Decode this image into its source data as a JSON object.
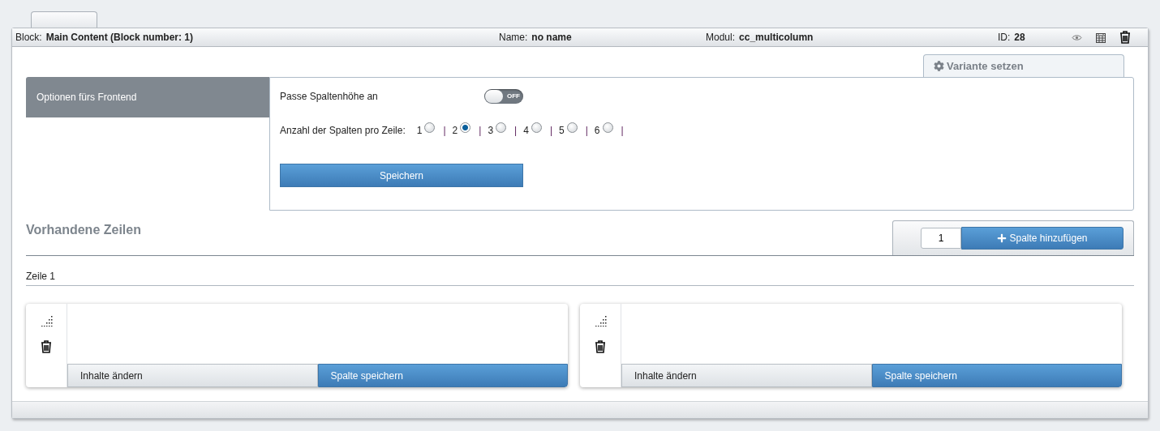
{
  "header": {
    "block_label": "Block:",
    "block_value": "Main Content (Block number: 1)",
    "name_label": "Name:",
    "name_value": "no name",
    "module_label": "Modul:",
    "module_value": "cc_multicolumn",
    "id_label": "ID:",
    "id_value": "28"
  },
  "variant_tab": {
    "label": "Variante setzen"
  },
  "options": {
    "title": "Optionen fürs Frontend",
    "toggle": {
      "label": "Passe Spaltenhöhe an",
      "on": false,
      "off_text": "OFF"
    },
    "columns": {
      "label": "Anzahl der Spalten pro Zeile:",
      "choices": [
        {
          "label": "1",
          "selected": false,
          "separator": "|"
        },
        {
          "label": "2",
          "selected": true,
          "separator": "|"
        },
        {
          "label": "3",
          "selected": false,
          "separator": "|"
        },
        {
          "label": "4",
          "selected": false,
          "separator": "|"
        },
        {
          "label": "5",
          "selected": false,
          "separator": "|"
        },
        {
          "label": "6",
          "selected": false,
          "separator": "|"
        }
      ]
    },
    "save_button": "Speichern"
  },
  "rows_section": {
    "title": "Vorhandene Zeilen",
    "count_value": "1",
    "add_button": "Spalte hinzufügen"
  },
  "rows": [
    {
      "title": "Zeile 1",
      "columns": [
        {
          "edit_button": "Inhalte ändern",
          "save_button": "Spalte speichern"
        },
        {
          "edit_button": "Inhalte ändern",
          "save_button": "Spalte speichern"
        }
      ]
    }
  ]
}
